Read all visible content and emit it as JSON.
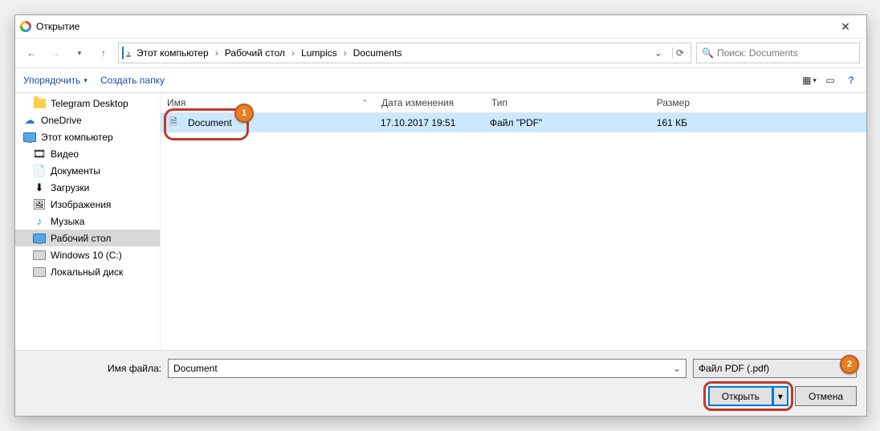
{
  "window": {
    "title": "Открытие"
  },
  "breadcrumb": [
    "Этот компьютер",
    "Рабочий стол",
    "Lumpics",
    "Documents"
  ],
  "search": {
    "placeholder": "Поиск: Documents"
  },
  "toolbar": {
    "organize": "Упорядочить",
    "new_folder": "Создать папку"
  },
  "tree": [
    {
      "label": "Telegram Desktop"
    },
    {
      "label": "OneDrive"
    },
    {
      "label": "Этот компьютер"
    },
    {
      "label": "Видео"
    },
    {
      "label": "Документы"
    },
    {
      "label": "Загрузки"
    },
    {
      "label": "Изображения"
    },
    {
      "label": "Музыка"
    },
    {
      "label": "Рабочий стол"
    },
    {
      "label": "Windows 10 (C:)"
    },
    {
      "label": "Локальный диск"
    }
  ],
  "columns": {
    "name": "Имя",
    "modified": "Дата изменения",
    "type": "Тип",
    "size": "Размер"
  },
  "files": [
    {
      "name": "Document",
      "modified": "17.10.2017 19:51",
      "type": "Файл \"PDF\"",
      "size": "161 КБ"
    }
  ],
  "footer": {
    "filename_label": "Имя файла:",
    "filename_value": "Document",
    "filter_value": "Файл PDF (.pdf)",
    "open_label": "Открыть",
    "cancel_label": "Отмена"
  },
  "annotations": [
    "1",
    "2"
  ]
}
